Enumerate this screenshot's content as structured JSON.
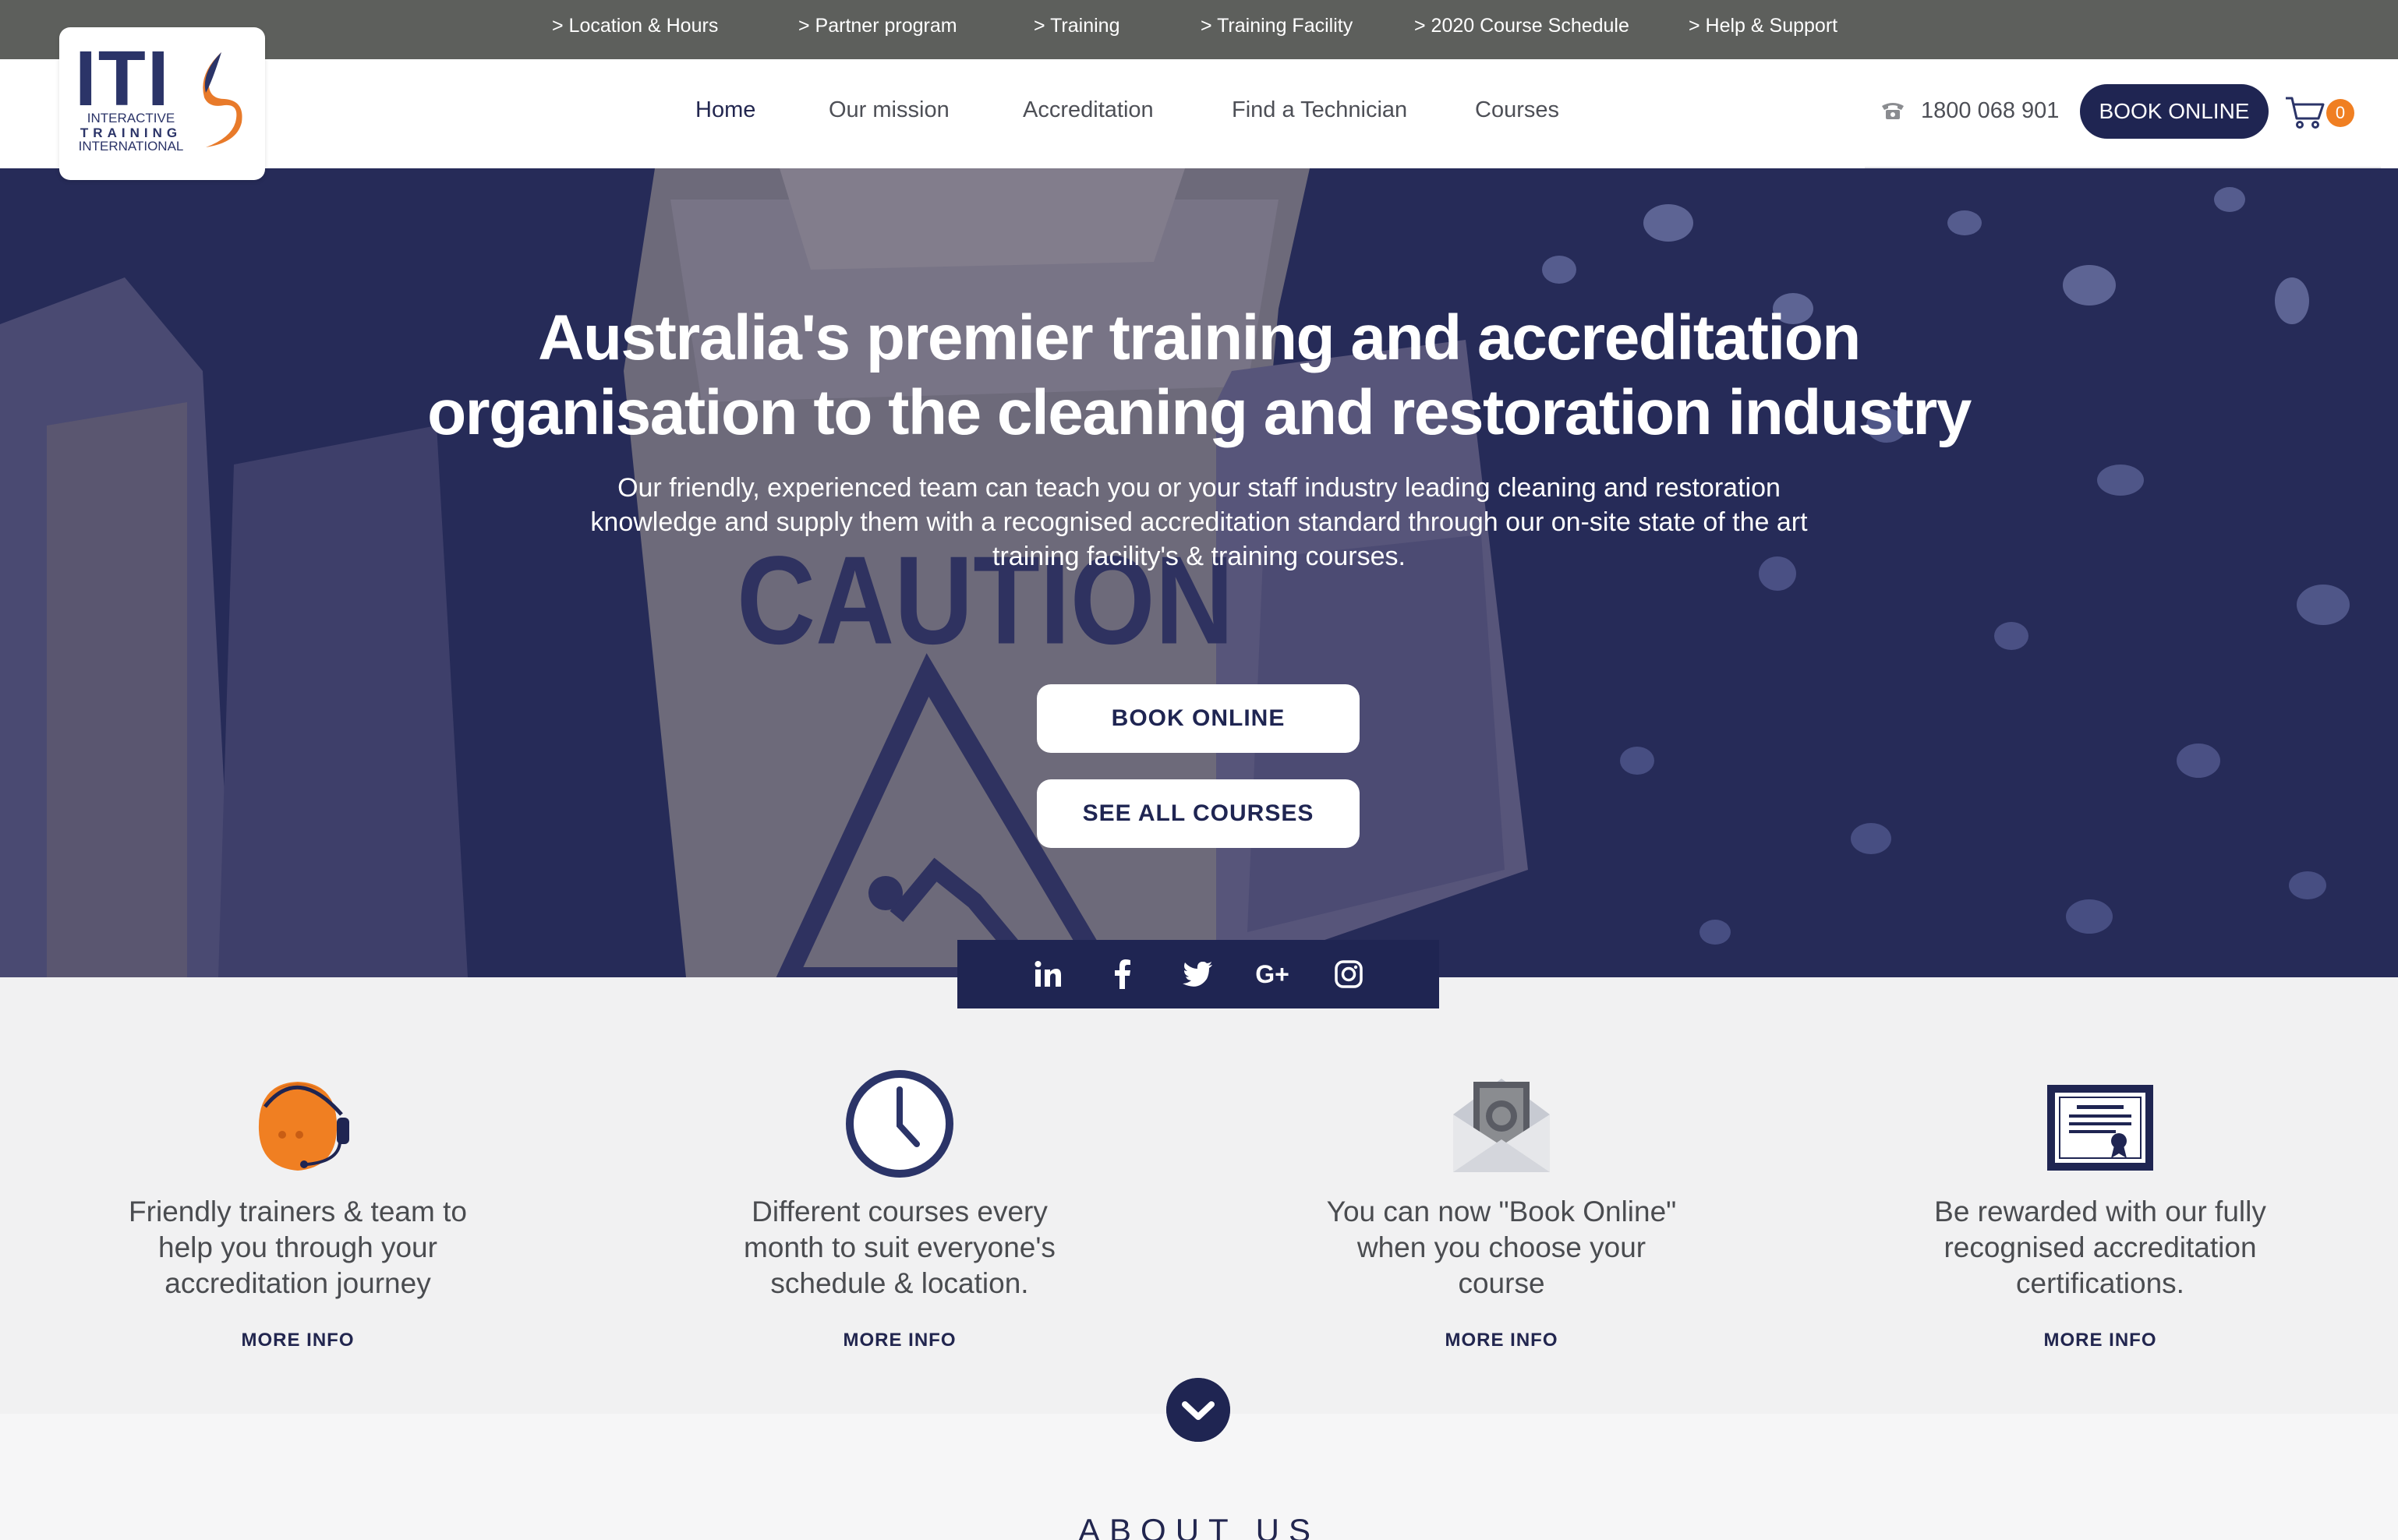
{
  "topbar": {
    "links": [
      "> Location & Hours",
      "> Partner program",
      "> Training",
      "> Training Facility",
      "> 2020 Course Schedule",
      "> Help & Support"
    ]
  },
  "logo": {
    "mark": "ITI",
    "line1": "INTERACTIVE",
    "line2": "TRAINING",
    "line3": "INTERNATIONAL"
  },
  "nav": {
    "items": [
      "Home",
      "Our mission",
      "Accreditation",
      "Find a Technician",
      "Courses"
    ],
    "active": "Home"
  },
  "header": {
    "phone": "1800 068 901",
    "book_label": "BOOK ONLINE",
    "cart_count": "0",
    "icons": [
      "phone-icon",
      "cart-icon"
    ]
  },
  "hero": {
    "title": "Australia's premier training and accreditation organisation to the cleaning and restoration industry",
    "subtitle": "Our friendly, experienced team can teach you or your staff industry leading cleaning and restoration knowledge and supply them with a recognised accreditation standard through our on-site state of the art training facility's & training courses.",
    "book_button": "BOOK ONLINE",
    "courses_button": "SEE ALL COURSES",
    "background_text": "CAUTION",
    "overlay_color": "#262b58"
  },
  "social": {
    "icons": [
      "linkedin-icon",
      "facebook-icon",
      "twitter-icon",
      "google-plus-icon",
      "instagram-icon"
    ]
  },
  "features": [
    {
      "icon": "headset-icon",
      "text": "Friendly trainers & team to help you through your accreditation journey",
      "more": "MORE INFO"
    },
    {
      "icon": "clock-icon",
      "text": "Different courses every month to suit everyone's schedule & location.",
      "more": "MORE INFO"
    },
    {
      "icon": "envelope-money-icon",
      "text": "You can now \"Book Online\" when you choose your course",
      "more": "MORE INFO"
    },
    {
      "icon": "certificate-icon",
      "text": "Be rewarded  with our fully recognised accreditation certifications.",
      "more": "MORE INFO"
    }
  ],
  "about": {
    "heading": "ABOUT US"
  },
  "colors": {
    "navy": "#1f2552",
    "orange": "#f07f22",
    "topbar": "#5d5f5c"
  }
}
